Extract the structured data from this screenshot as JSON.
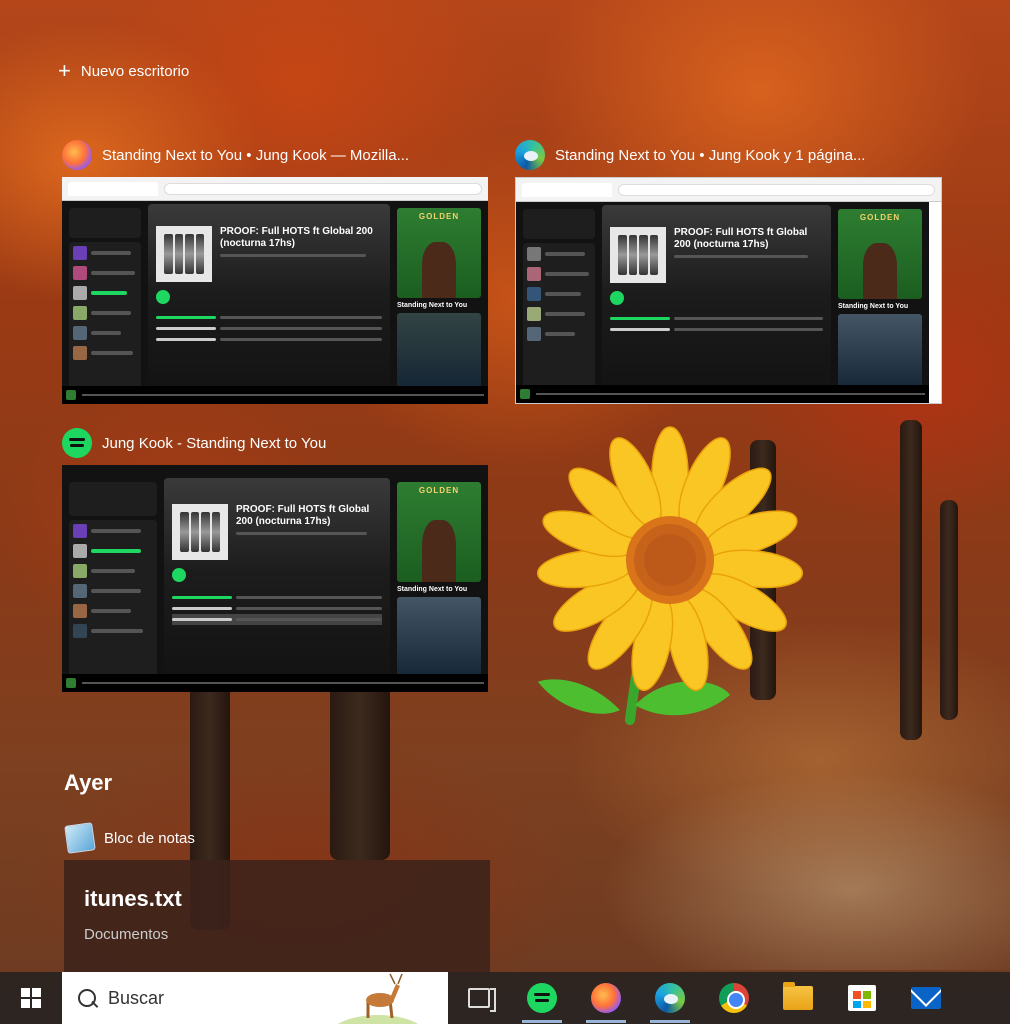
{
  "new_desktop": {
    "label": "Nuevo escritorio"
  },
  "windows": [
    {
      "title": "Standing Next to You • Jung Kook — Mozilla...",
      "app": "firefox-icon",
      "playlist_title": "PROOF: Full HOTS ft Global 200 (nocturna 17hs)",
      "now_playing": "Standing Next to You",
      "right_cover": "GOLDEN"
    },
    {
      "title": "Standing Next to You • Jung Kook y 1 página...",
      "app": "edge-icon",
      "playlist_title": "PROOF: Full HOTS ft Global 200 (nocturna 17hs)",
      "now_playing": "Standing Next to You",
      "right_cover": "GOLDEN"
    },
    {
      "title": "Jung Kook - Standing Next to You",
      "app": "spotify-icon",
      "playlist_title": "PROOF: Full HOTS ft Global 200 (nocturna 17hs)",
      "now_playing": "Standing Next to You",
      "right_cover": "GOLDEN"
    }
  ],
  "timeline": {
    "group": "Ayer",
    "app_name": "Bloc de notas",
    "activity_title": "itunes.txt",
    "activity_location": "Documentos"
  },
  "taskbar": {
    "search_placeholder": "Buscar",
    "apps": [
      "spotify-icon",
      "firefox-icon",
      "edge-icon",
      "chrome-icon",
      "file-explorer-icon",
      "store-icon",
      "mail-icon"
    ]
  }
}
